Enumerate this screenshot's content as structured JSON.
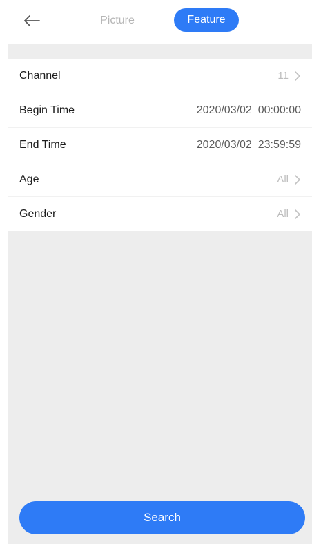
{
  "header": {
    "back_icon": "arrow-left-icon",
    "tabs": [
      {
        "label": "Picture",
        "active": false
      },
      {
        "label": "Feature",
        "active": true
      }
    ]
  },
  "filters": {
    "channel": {
      "label": "Channel",
      "value": "11",
      "icon": "chevron-right-icon"
    },
    "begin_time": {
      "label": "Begin Time",
      "value": "2020/03/02  00:00:00"
    },
    "end_time": {
      "label": "End Time",
      "value": "2020/03/02  23:59:59"
    },
    "age": {
      "label": "Age",
      "value": "All",
      "icon": "chevron-right-icon"
    },
    "gender": {
      "label": "Gender",
      "value": "All",
      "icon": "chevron-right-icon"
    }
  },
  "search_button": {
    "label": "Search"
  },
  "colors": {
    "accent": "#2e7bf6",
    "background": "#ededed",
    "inactive_tab": "#b5b5b5",
    "muted_value": "#bdbdbd"
  }
}
